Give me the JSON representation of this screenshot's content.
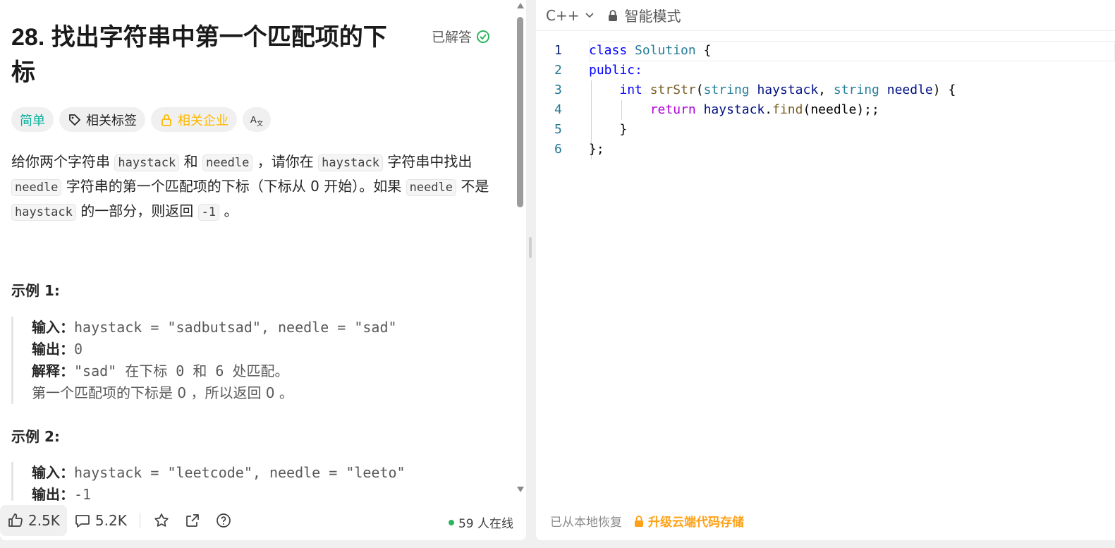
{
  "problem": {
    "title": "28. 找出字符串中第一个匹配项的下标",
    "status": "已解答",
    "tags": {
      "difficulty": "简单",
      "related_tags": "相关标签",
      "related_companies": "相关企业",
      "translate": "A文"
    },
    "desc": {
      "p1": "给你两个字符串",
      "c1": "haystack",
      "p2": "和",
      "c2": "needle",
      "p3": "，请你在",
      "c3": "haystack",
      "p4": "字符串中找出",
      "c4": "needle",
      "p5": "字符串的第一个匹配项的下标（下标从 0 开始）。如果",
      "c5": "needle",
      "p6": "不是",
      "c6": "haystack",
      "p7": "的一部分，则返回",
      "c7": "-1",
      "p8": "。"
    },
    "example1": {
      "title": "示例 1:",
      "input_label": "输入：",
      "input": "haystack = \"sadbutsad\", needle = \"sad\"",
      "output_label": "输出：",
      "output": "0",
      "explain_label": "解释：",
      "explain1": "\"sad\" 在下标 0 和 6 处匹配。",
      "explain2": "第一个匹配项的下标是 0 ，所以返回 0 。"
    },
    "example2": {
      "title": "示例 2:",
      "input_label": "输入：",
      "input": "haystack = \"leetcode\", needle = \"leeto\"",
      "output_label": "输出：",
      "output": "-1"
    }
  },
  "bottom_bar": {
    "likes": "2.5K",
    "comments": "5.2K",
    "online": "59 人在线"
  },
  "editor": {
    "language": "C++",
    "mode": "智能模式",
    "line_numbers": [
      "1",
      "2",
      "3",
      "4",
      "5",
      "6"
    ],
    "footer_restored": "已从本地恢复",
    "footer_upgrade": "升级云端代码存储"
  },
  "code": {
    "l1_kw": "class",
    "l1_ty": "Solution",
    "l1_rest": " {",
    "l2_kw": "public:",
    "l3_kw": "int",
    "l3_fn": "strStr",
    "l3_p1": "(",
    "l3_ty1": "string",
    "l3_pr1": "haystack",
    "l3_p2": ", ",
    "l3_ty2": "string",
    "l3_pr2": "needle",
    "l3_p3": ") {",
    "l4_ctl": "return",
    "l4_pr": "haystack",
    "l4_dot": ".",
    "l4_fn": "find",
    "l4_rest": "(needle);;",
    "l5": "}",
    "l6": "};"
  },
  "colors": {
    "easy": "#00af9b",
    "company": "#ffb800",
    "accent": "#ffa116",
    "solved": "#2db55d"
  }
}
